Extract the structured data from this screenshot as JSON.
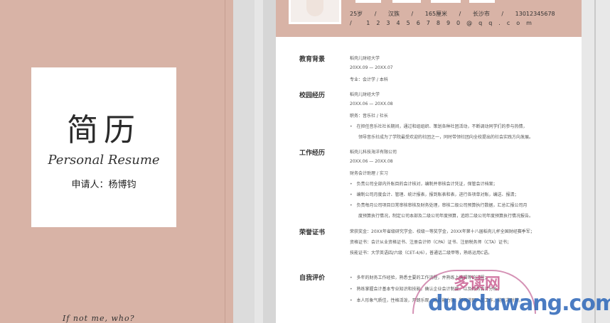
{
  "cover": {
    "title": "简历",
    "subtitle": "Personal Resume",
    "applicant": "申请人：杨博钧",
    "quote": "If not me, who?"
  },
  "header": {
    "info": [
      "25岁",
      "/",
      "汉族",
      "/",
      "165厘米",
      "/",
      "长沙市",
      "/",
      "13012345678"
    ],
    "email": "/ 1234567890@qq.com"
  },
  "sections": {
    "education": {
      "label": "教育背景",
      "lines": [
        "稻壳儿财经大学",
        "20XX.09 — 20XX.07",
        "专业：会计学 / 本科"
      ]
    },
    "campus": {
      "label": "校园经历",
      "lines": [
        "稻壳儿财经大学",
        "20XX.06 — 20XX.08",
        "职务：音乐社 / 社长"
      ],
      "bullets": [
        "在担任音乐社社长期间，通过和组组织、策划各种社团活动，不断调动同学们的参与热情，"
      ],
      "bullet_cont": "领导音乐社成为了学院最受欢迎的社团之一，同时带领社团向全校提出的社会实践方向发展。"
    },
    "work": {
      "label": "工作经历",
      "lines": [
        "稻壳儿科技海洋有限公司",
        "20XX.06 — 20XX.08",
        "财务会计助理 / 实习"
      ],
      "bullets": [
        "负责公司全部内外账目的会计核对，编制并审核会计凭证，保管会计档案；",
        "编制公司月度会计、管理、统计报表，报到账表和表，进行各项单对账，编送、报清；",
        "负责每月公司项目日常审核审核及财务处理，审核二级公司预算执行数据，汇总汇报公司月"
      ],
      "bullet_cont": "度预算执行情况，制定公司本部及二级公司年度预算，追踪二级公司年度预算执行情况报告。"
    },
    "awards": {
      "label": "荣誉证书",
      "lines": [
        "荣获奖金：20XX年省级研究学金、校级一等奖学金，20XX年第十八届稻壳儿杯全国财经赛季军；",
        "资格证书：会计从业资格证书、注册会计师（CPA）证书、注册税务师（CTA）证书；",
        "技能证书：大学英语四/六级（CET-4/6），普通话二级甲等，熟练运用C语。"
      ]
    },
    "self": {
      "label": "自我评价",
      "bullets": [
        "多年的财务工作经验，熟悉主要的工作流程，并熟练上编辑等的过程；",
        "熟练掌握会计基本专业知识和技能，确认企业会计制度，以及财务会计分析；",
        "本人形象气质佳，性格活泼，开朗乐观，适应能力强，积极进取一定工作，能吃苦耐劳。"
      ]
    }
  },
  "watermark": {
    "cn": "多读网",
    "text": "duoduwang.com"
  }
}
